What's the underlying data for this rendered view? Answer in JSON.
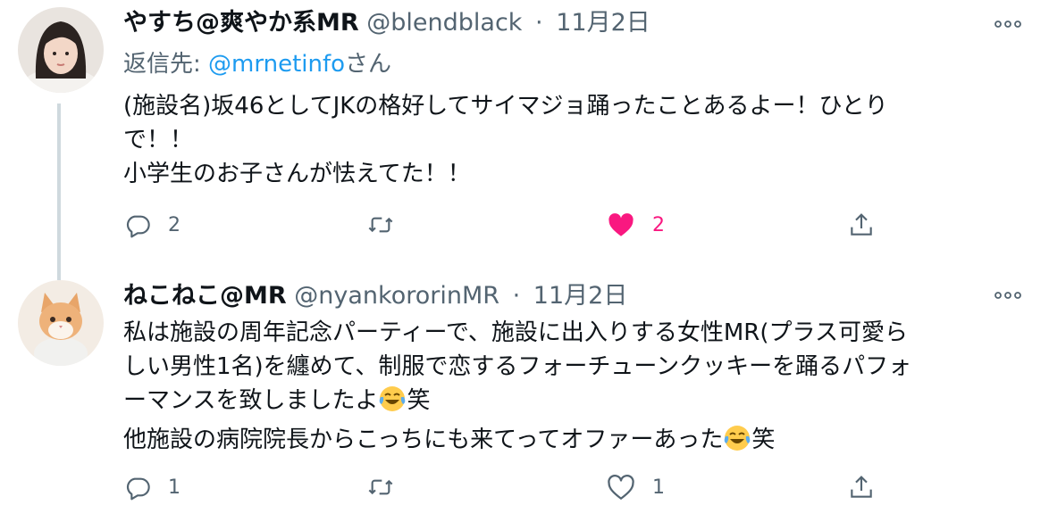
{
  "tweets": [
    {
      "display_name": "やすち@爽やか系MR",
      "handle": "@blendblack",
      "separator": "·",
      "date": "11月2日",
      "reply_prefix": "返信先: ",
      "reply_mention": "@mrnetinfo",
      "reply_suffix": "さん",
      "text_lines": [
        "(施設名)坂46としてJKの格好してサイマジョ踊ったことあるよー！ひとり",
        "で！！",
        "小学生のお子さんが怯えてた！！"
      ],
      "reply_count": "2",
      "retweet_count": "",
      "like_count": "2",
      "liked": true
    },
    {
      "display_name": "ねこねこ@MR",
      "handle": "@nyankororinMR",
      "separator": "·",
      "date": "11月2日",
      "text_lines": [
        "私は施設の周年記念パーティーで、施設に出入りする女性MR(プラス可愛ら",
        "しい男性1名)を纏めて、制服で恋するフォーチューンクッキーを踊るパフォ"
      ],
      "line3": "ーマンスを致しましたよ",
      "line3_tail": "笑",
      "line4": "他施設の病院院長からこっちにも来てってオファーあった",
      "line4_tail": "笑",
      "reply_count": "1",
      "retweet_count": "",
      "like_count": "1",
      "liked": false
    }
  ],
  "colors": {
    "text": "#0f1419",
    "secondary": "#536471",
    "link": "#1d9bf0",
    "like": "#f91880",
    "thread_line": "#cfd9de"
  },
  "icons": {
    "reply": "reply-icon",
    "retweet": "retweet-icon",
    "like": "heart-icon",
    "share": "share-icon",
    "more": "more-icon",
    "emoji": "face-with-tears-of-joy-emoji"
  }
}
